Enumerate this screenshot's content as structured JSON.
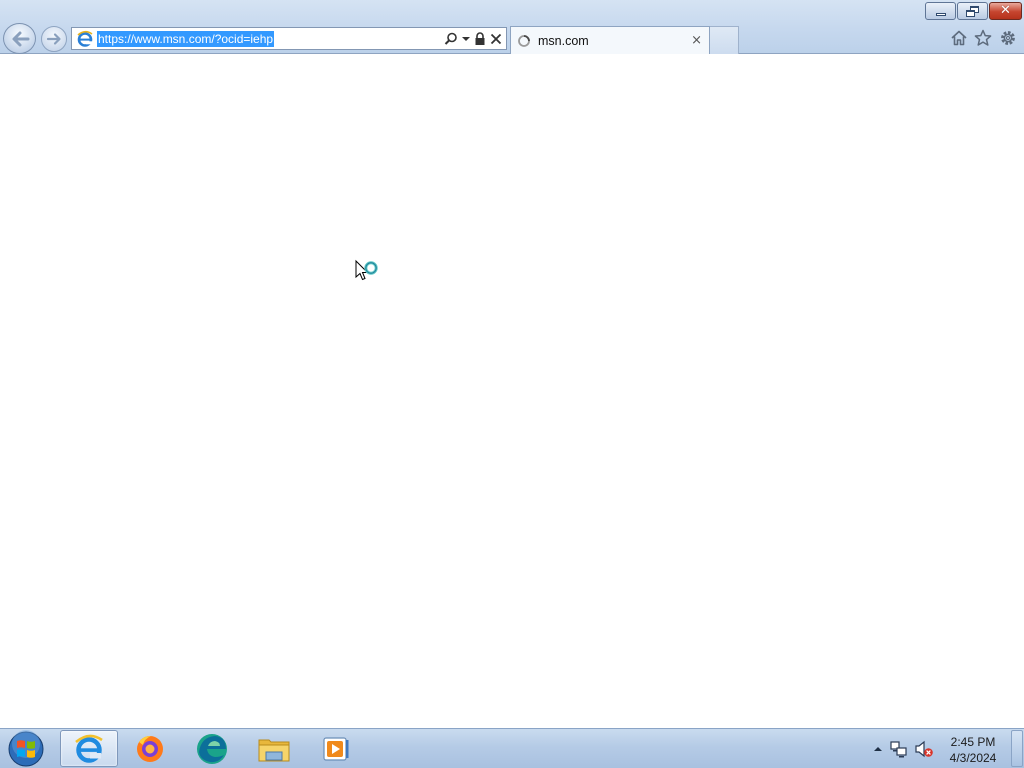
{
  "window": {
    "caption_buttons": {
      "minimize_icon": "minimize-icon",
      "restore_icon": "restore-icon",
      "close_icon": "close-icon",
      "close_color": "#c6452f"
    }
  },
  "navigation": {
    "back_icon": "back-arrow-icon",
    "forward_icon": "forward-arrow-icon"
  },
  "address_bar": {
    "url": "https://www.msn.com/?ocid=iehp",
    "selected": true,
    "selection_color": "#3399ff",
    "page_icon": "ie-page-icon",
    "tools": [
      "search-icon",
      "dropdown-icon",
      "lock-icon",
      "stop-icon"
    ]
  },
  "tabs": [
    {
      "label": "msn.com",
      "active": true,
      "loading": true,
      "icon": "loading-spinner-icon",
      "close": "×"
    }
  ],
  "toolbar_right": [
    "home-icon",
    "favorites-star-icon",
    "tools-gear-icon"
  ],
  "content": {
    "state": "loading",
    "cursor": "busy-cursor"
  },
  "taskbar": {
    "start_icon": "windows-start-icon",
    "pinned": [
      {
        "name": "Internet Explorer",
        "icon": "ie-icon",
        "active": true
      },
      {
        "name": "Firefox",
        "icon": "firefox-icon",
        "active": false
      },
      {
        "name": "Edge",
        "icon": "edge-icon",
        "active": false
      },
      {
        "name": "File Explorer",
        "icon": "explorer-icon",
        "active": false
      },
      {
        "name": "Media Player",
        "icon": "media-player-icon",
        "active": false
      }
    ],
    "tray": {
      "icons": [
        "show-hidden-icons-arrow",
        "network-icon",
        "volume-muted-icon"
      ],
      "time": "2:45 PM",
      "date": "4/3/2024"
    }
  }
}
